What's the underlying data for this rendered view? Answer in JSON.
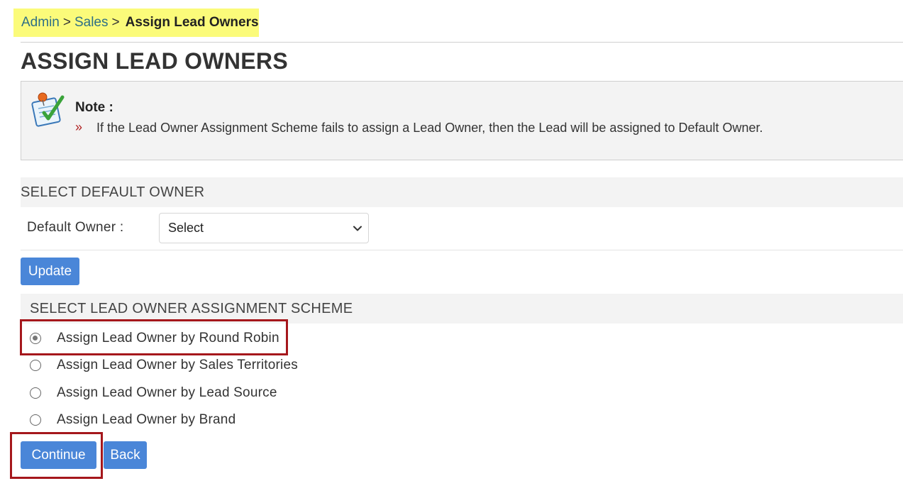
{
  "breadcrumb": {
    "items": [
      "Admin",
      "Sales"
    ],
    "separator": ">",
    "current": "Assign Lead Owners"
  },
  "page_title": "ASSIGN LEAD OWNERS",
  "note": {
    "icon": "notepad-pin-icon",
    "title": "Note :",
    "bullet": "»",
    "text": "If the Lead Owner Assignment Scheme fails to assign a Lead Owner, then the Lead will be assigned to Default Owner."
  },
  "default_owner_section": {
    "heading": "SELECT DEFAULT OWNER",
    "label": "Default Owner :",
    "select_value": "Select",
    "update_label": "Update"
  },
  "scheme_section": {
    "heading": "SELECT LEAD OWNER ASSIGNMENT SCHEME",
    "options": [
      {
        "label": "Assign Lead Owner by Round Robin",
        "checked": true
      },
      {
        "label": "Assign Lead Owner by Sales Territories",
        "checked": false
      },
      {
        "label": "Assign Lead Owner by Lead Source",
        "checked": false
      },
      {
        "label": "Assign Lead Owner by Brand",
        "checked": false
      }
    ]
  },
  "actions": {
    "continue_label": "Continue",
    "back_label": "Back"
  },
  "colors": {
    "breadcrumb_bg": "#fbfb7a",
    "button_blue": "#4a86d8",
    "highlight_red": "#a5171c",
    "link": "#2e6f86"
  }
}
